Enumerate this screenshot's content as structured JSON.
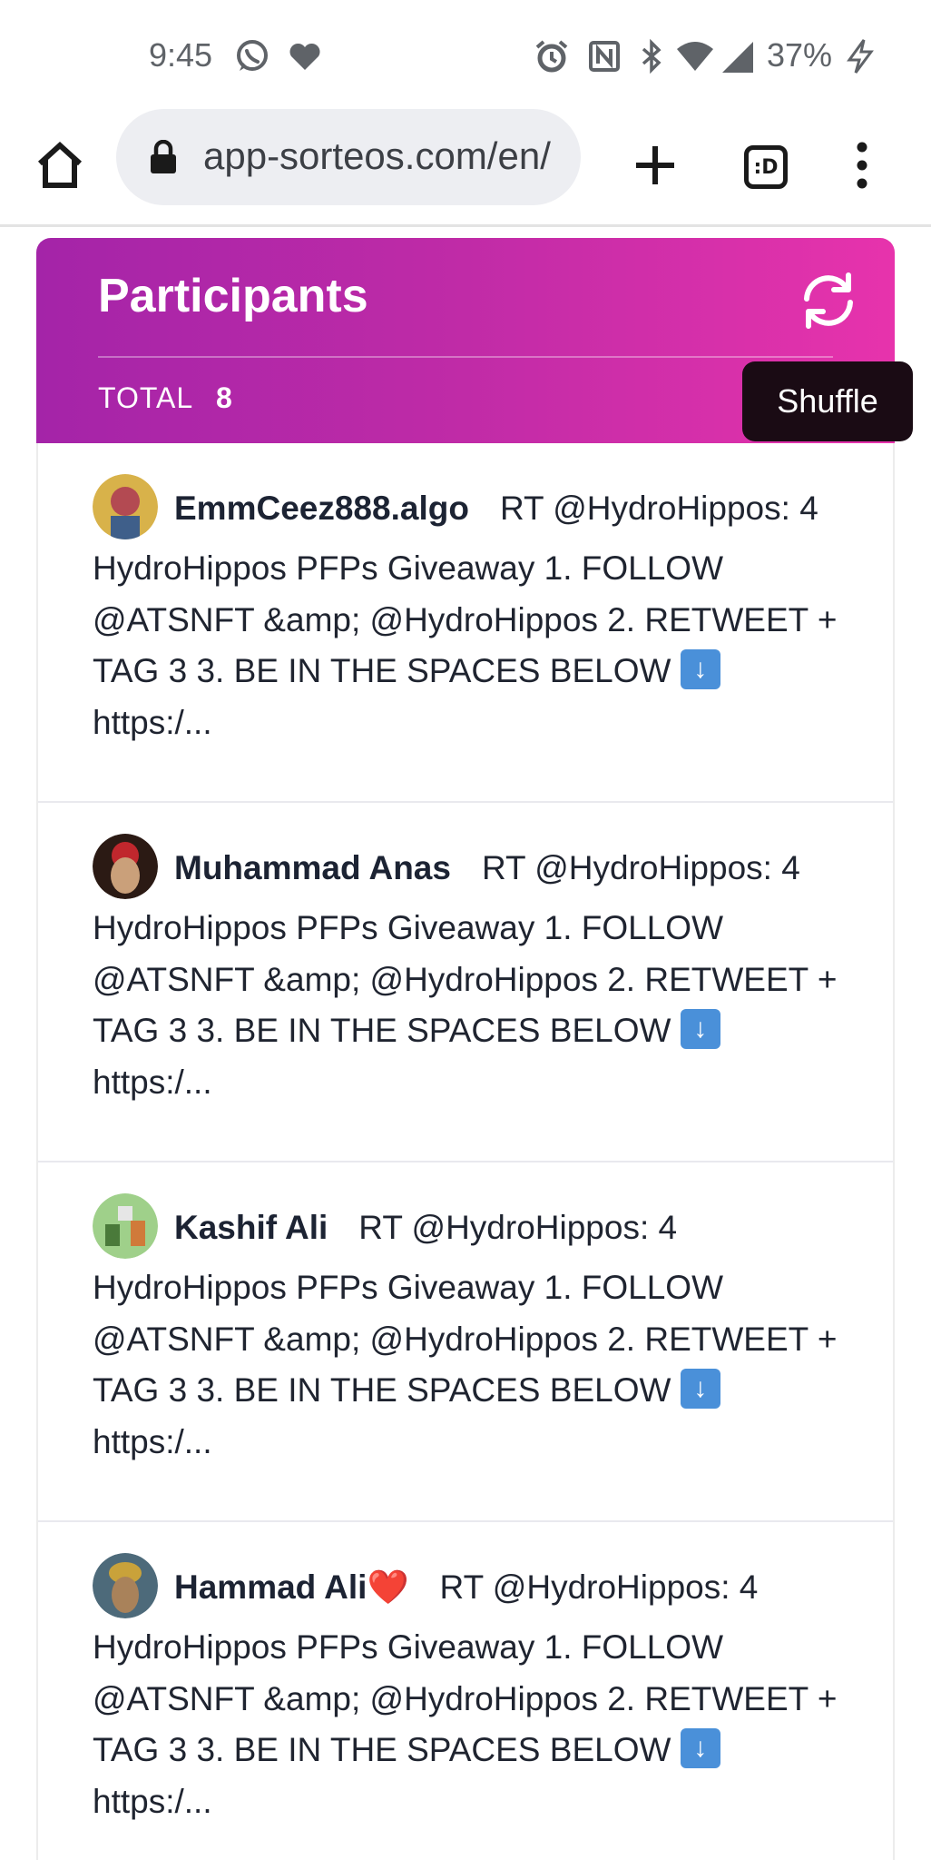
{
  "status_bar": {
    "time": "9:45",
    "battery": "37%",
    "left_icons": [
      "whatsapp-icon",
      "heart-icon"
    ],
    "right_icons": [
      "alarm-icon",
      "nfc-icon",
      "bluetooth-icon",
      "wifi-icon",
      "signal-icon",
      "charging-icon"
    ]
  },
  "browser": {
    "url": "app-sorteos.com/en/",
    "tab_count": ":D"
  },
  "participants": {
    "title": "Participants",
    "total_label": "TOTAL",
    "total_count": "8",
    "shuffle_tooltip": "Shuffle",
    "accent_colors": [
      "#a424a8",
      "#e733ac"
    ],
    "items": [
      {
        "name": "EmmCeez888.algo",
        "text_before": "RT @HydroHippos: 4 HydroHippos PFPs Giveaway 1. FOLLOW @ATSNFT &amp; @HydroHippos 2. RETWEET + TAG 3 3. BE IN THE SPACES BELOW",
        "emoji": "⬇️",
        "text_after": "https:/...",
        "avatar_color": "#c9a23a"
      },
      {
        "name": "Muhammad Anas",
        "text_before": "RT @HydroHippos: 4 HydroHippos PFPs Giveaway 1. FOLLOW @ATSNFT &amp; @HydroHippos 2. RETWEET + TAG 3 3. BE IN THE SPACES BELOW",
        "emoji": "⬇️",
        "text_after": "https:/...",
        "avatar_color": "#2b1a14"
      },
      {
        "name": "Kashif Ali",
        "text_before": "RT @HydroHippos: 4 HydroHippos PFPs Giveaway 1. FOLLOW @ATSNFT &amp; @HydroHippos 2. RETWEET + TAG 3 3. BE IN THE SPACES BELOW",
        "emoji": "⬇️",
        "text_after": "https:/...",
        "avatar_color": "#7bbf6a"
      },
      {
        "name": "Hammad Ali❤️",
        "text_before": "RT @HydroHippos: 4 HydroHippos PFPs Giveaway 1. FOLLOW @ATSNFT &amp; @HydroHippos 2. RETWEET + TAG 3 3. BE IN THE SPACES BELOW",
        "emoji": "⬇️",
        "text_after": "https:/...",
        "avatar_color": "#4d6a7a"
      }
    ]
  }
}
